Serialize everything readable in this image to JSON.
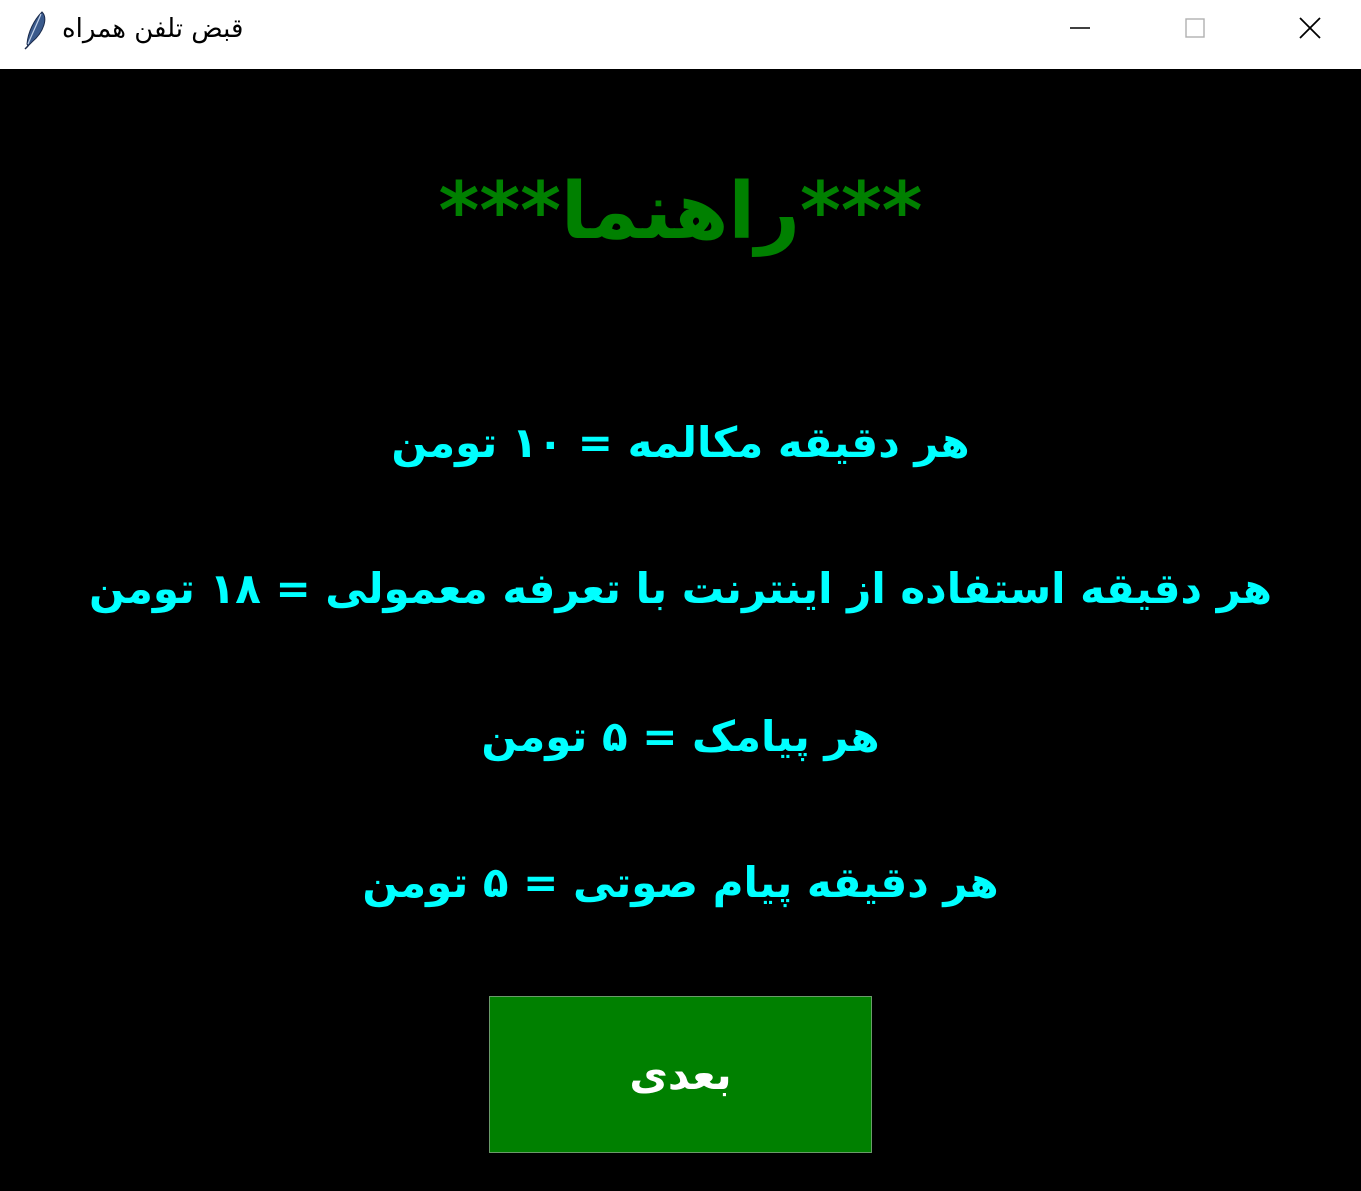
{
  "window": {
    "title": "قبض تلفن همراه",
    "icon": "feather-icon",
    "controls": {
      "minimize_icon": "minimize-icon",
      "maximize_icon": "maximize-icon",
      "close_icon": "close-icon"
    }
  },
  "main": {
    "heading": "***راهنما***",
    "rates": [
      "هر دقیقه مکالمه = ۱۰ تومن",
      "هر دقیقه استفاده از اینترنت با تعرفه معمولی = ۱۸ تومن",
      "هر پیامک = ۵ تومن",
      "هر دقیقه پیام صوتی = ۵ تومن"
    ],
    "next_button_label": "بعدی"
  },
  "colors": {
    "background": "#000000",
    "heading": "#008000",
    "rate_text": "#00ffff",
    "button_bg": "#008000",
    "button_text": "#ffffff"
  }
}
